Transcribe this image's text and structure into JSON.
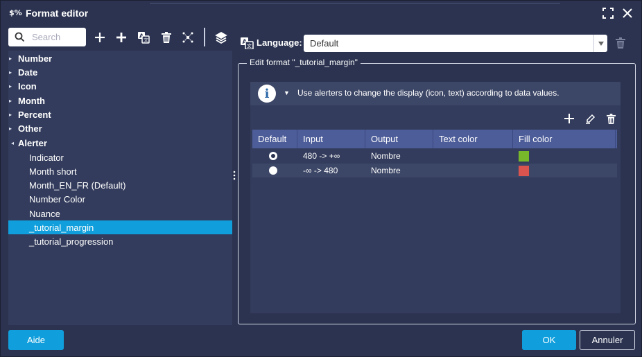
{
  "window": {
    "app_icon": "$%",
    "title": "Format editor",
    "controls": [
      "fullscreen-icon",
      "close-icon"
    ]
  },
  "left": {
    "search": {
      "value": "",
      "placeholder": "Search"
    },
    "toolbar_icons": [
      "add-icon",
      "add-child-icon",
      "translate-icon",
      "delete-icon",
      "hierarchy-icon",
      "layers-icon"
    ],
    "tree": {
      "categories": [
        "Number",
        "Date",
        "Icon",
        "Month",
        "Percent",
        "Other"
      ],
      "expanded": {
        "label": "Alerter"
      },
      "children": [
        "Indicator",
        "Month short",
        "Month_EN_FR (Default)",
        "Number Color",
        "Nuance",
        "_tutorial_margin",
        "_tutorial_progression"
      ],
      "selected": "_tutorial_margin"
    }
  },
  "right": {
    "language_label": "Language:",
    "language_value": "Default",
    "legend": "Edit format \"_tutorial_margin\"",
    "info_text": "Use alerters to change the display (icon, text) according to data values.",
    "table_tools": [
      "add-icon",
      "edit-icon",
      "delete-icon"
    ],
    "table": {
      "headers": [
        "Default",
        "Input",
        "Output",
        "Text color",
        "Fill color"
      ],
      "rows": [
        {
          "default": true,
          "input": "480 -> +∞",
          "output": "Nombre",
          "text_color": "",
          "fill_color": "#76b82a"
        },
        {
          "default": false,
          "input": "-∞ -> 480",
          "output": "Nombre",
          "text_color": "",
          "fill_color": "#d9534f"
        }
      ]
    }
  },
  "footer": {
    "help": "Aide",
    "ok": "OK",
    "cancel": "Annuler"
  },
  "colors": {
    "accent": "#109fdc",
    "background": "#2b3350",
    "panel": "#333c5c",
    "table_header": "#4d5d99"
  }
}
